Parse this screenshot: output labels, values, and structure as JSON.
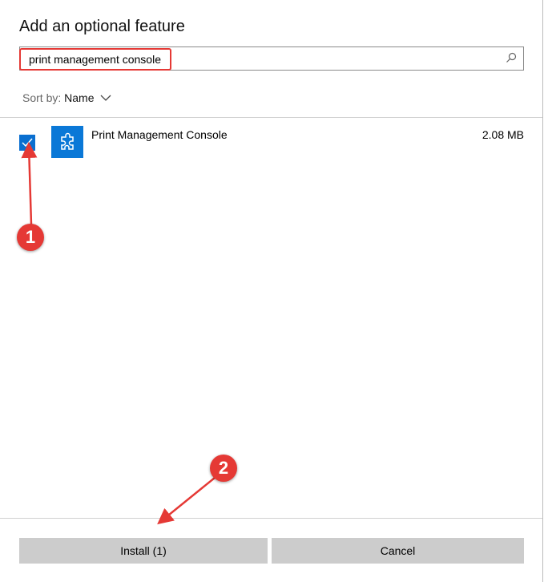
{
  "dialog": {
    "title": "Add an optional feature"
  },
  "search": {
    "value": "print management console",
    "icon": "search-icon"
  },
  "sort": {
    "label": "Sort by:",
    "value": "Name"
  },
  "features": [
    {
      "name": "Print Management Console",
      "size": "2.08 MB",
      "checked": true,
      "icon": "puzzle-icon"
    }
  ],
  "buttons": {
    "install": "Install (1)",
    "cancel": "Cancel"
  },
  "annotations": {
    "step1": "1",
    "step2": "2",
    "color": "#e53935"
  }
}
